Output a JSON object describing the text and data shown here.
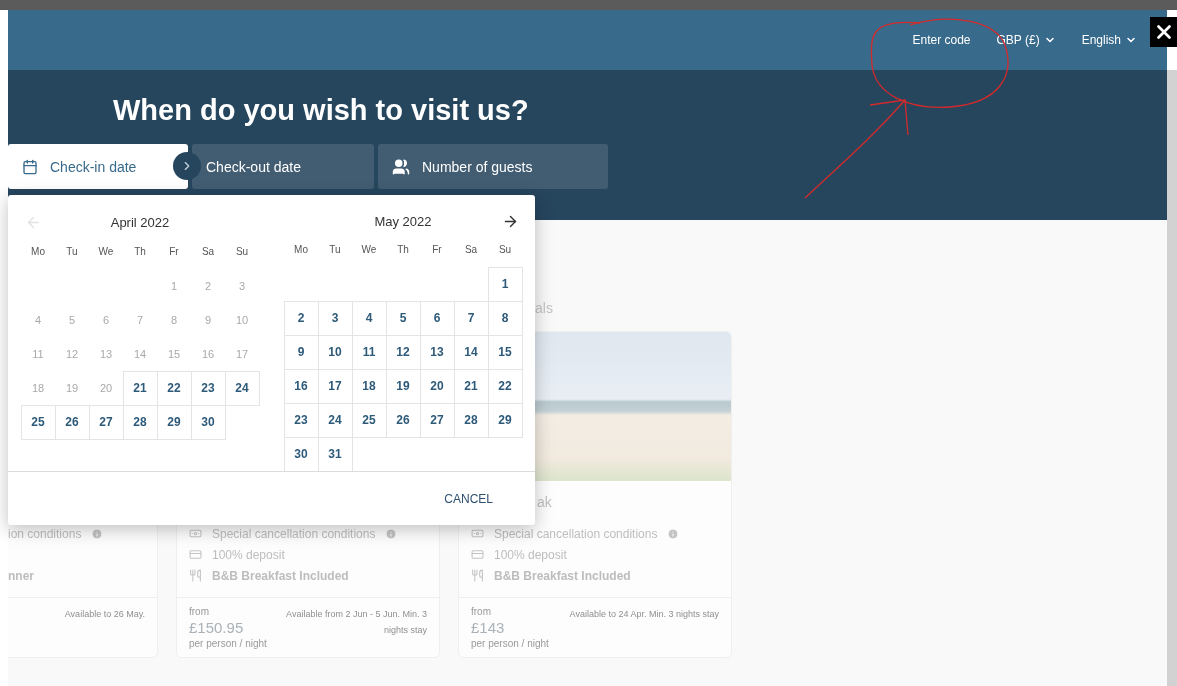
{
  "header": {
    "links": [
      {
        "label": "Enter code",
        "dropdown": false
      },
      {
        "label": "GBP (£)",
        "dropdown": true
      },
      {
        "label": "English",
        "dropdown": true
      }
    ]
  },
  "hero": {
    "title": "When do you wish to visit us?",
    "fields": [
      {
        "label": "Check-in date",
        "kind": "calendar",
        "selected": true
      },
      {
        "label": "Check-out date",
        "kind": "plain",
        "selected": false
      },
      {
        "label": "Number of guests",
        "kind": "guests",
        "selected": false
      }
    ]
  },
  "calendar": {
    "prev_disabled": true,
    "next_disabled": false,
    "cancel": "CANCEL",
    "months": [
      {
        "title": "April 2022",
        "weekdays": [
          "Mo",
          "Tu",
          "We",
          "Th",
          "Fr",
          "Sa",
          "Su"
        ],
        "weeks": [
          [
            {
              "label": "1",
              "disabled": true
            },
            {
              "label": "2",
              "disabled": true
            },
            {
              "label": "3",
              "disabled": true
            }
          ],
          [
            {
              "label": "4",
              "disabled": true
            },
            {
              "label": "5",
              "disabled": true
            },
            {
              "label": "6",
              "disabled": true
            },
            {
              "label": "7",
              "disabled": true
            },
            {
              "label": "8",
              "disabled": true
            },
            {
              "label": "9",
              "disabled": true
            },
            {
              "label": "10",
              "disabled": true
            }
          ],
          [
            {
              "label": "11",
              "disabled": true
            },
            {
              "label": "12",
              "disabled": true
            },
            {
              "label": "13",
              "disabled": true
            },
            {
              "label": "14",
              "disabled": true
            },
            {
              "label": "15",
              "disabled": true
            },
            {
              "label": "16",
              "disabled": true
            },
            {
              "label": "17",
              "disabled": true
            }
          ],
          [
            {
              "label": "18",
              "disabled": true
            },
            {
              "label": "19",
              "disabled": true
            },
            {
              "label": "20",
              "disabled": true
            },
            {
              "label": "21",
              "disabled": false
            },
            {
              "label": "22",
              "disabled": false
            },
            {
              "label": "23",
              "disabled": false
            },
            {
              "label": "24",
              "disabled": false
            }
          ],
          [
            {
              "label": "25",
              "disabled": false
            },
            {
              "label": "26",
              "disabled": false
            },
            {
              "label": "27",
              "disabled": false
            },
            {
              "label": "28",
              "disabled": false
            },
            {
              "label": "29",
              "disabled": false
            },
            {
              "label": "30",
              "disabled": false
            }
          ]
        ]
      },
      {
        "title": "May 2022",
        "weekdays": [
          "Mo",
          "Tu",
          "We",
          "Th",
          "Fr",
          "Sa",
          "Su"
        ],
        "weeks": [
          [
            {
              "label": "1",
              "disabled": false
            }
          ],
          [
            {
              "label": "2",
              "disabled": false
            },
            {
              "label": "3",
              "disabled": false
            },
            {
              "label": "4",
              "disabled": false
            },
            {
              "label": "5",
              "disabled": false
            },
            {
              "label": "6",
              "disabled": false
            },
            {
              "label": "7",
              "disabled": false
            },
            {
              "label": "8",
              "disabled": false
            }
          ],
          [
            {
              "label": "9",
              "disabled": false
            },
            {
              "label": "10",
              "disabled": false
            },
            {
              "label": "11",
              "disabled": false
            },
            {
              "label": "12",
              "disabled": false
            },
            {
              "label": "13",
              "disabled": false
            },
            {
              "label": "14",
              "disabled": false
            },
            {
              "label": "15",
              "disabled": false
            }
          ],
          [
            {
              "label": "16",
              "disabled": false
            },
            {
              "label": "17",
              "disabled": false
            },
            {
              "label": "18",
              "disabled": false
            },
            {
              "label": "19",
              "disabled": false
            },
            {
              "label": "20",
              "disabled": false
            },
            {
              "label": "21",
              "disabled": false
            },
            {
              "label": "22",
              "disabled": false
            }
          ],
          [
            {
              "label": "23",
              "disabled": false
            },
            {
              "label": "24",
              "disabled": false
            },
            {
              "label": "25",
              "disabled": false
            },
            {
              "label": "26",
              "disabled": false
            },
            {
              "label": "27",
              "disabled": false
            },
            {
              "label": "28",
              "disabled": false
            },
            {
              "label": "29",
              "disabled": false
            }
          ],
          [
            {
              "label": "30",
              "disabled": false
            },
            {
              "label": "31",
              "disabled": false
            }
          ]
        ]
      }
    ]
  },
  "section_heading": "als",
  "offers": [
    {
      "clipped": true,
      "features": [
        {
          "kind": "cancellation",
          "text": "ion conditions"
        },
        {
          "kind": "meal",
          "text": "nner"
        }
      ],
      "availability": "Available to 26 May."
    },
    {
      "clipped": false,
      "features": [
        {
          "kind": "cancellation",
          "text": "Special cancellation conditions"
        },
        {
          "kind": "deposit",
          "text": "100% deposit"
        },
        {
          "kind": "meal",
          "text": "B&B Breakfast Included"
        }
      ],
      "from": "from",
      "price": "£150.95",
      "unit": "per person / night",
      "availability": "Available from 2 Jun - 5 Jun. Min. 3 nights stay"
    },
    {
      "clipped": false,
      "photo": true,
      "title": "ak",
      "features": [
        {
          "kind": "cancellation",
          "text": "Special cancellation conditions"
        },
        {
          "kind": "deposit",
          "text": "100% deposit"
        },
        {
          "kind": "meal",
          "text": "B&B Breakfast Included"
        }
      ],
      "from": "from",
      "price": "£143",
      "unit": "per person / night",
      "availability": "Available to 24 Apr. Min. 3 nights stay"
    }
  ]
}
